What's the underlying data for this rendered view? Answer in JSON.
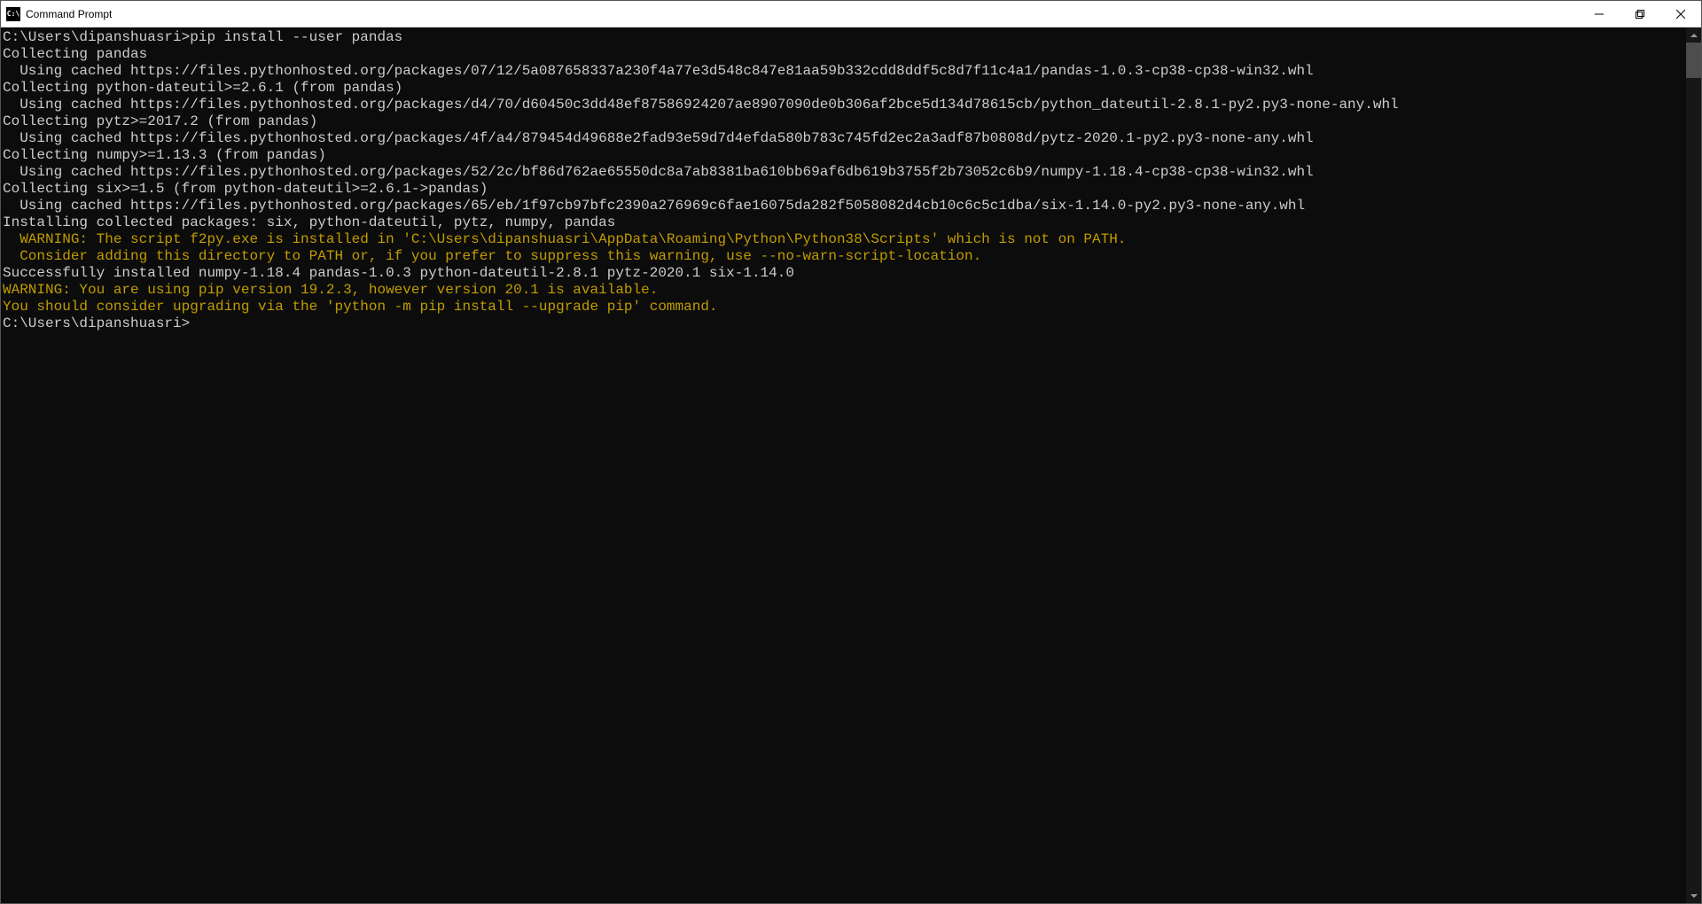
{
  "window": {
    "title": "Command Prompt",
    "icon_label": "C:\\"
  },
  "terminal": {
    "lines": [
      {
        "text": "C:\\Users\\dipanshuasri>pip install --user pandas",
        "cls": ""
      },
      {
        "text": "Collecting pandas",
        "cls": ""
      },
      {
        "text": "  Using cached https://files.pythonhosted.org/packages/07/12/5a087658337a230f4a77e3d548c847e81aa59b332cdd8ddf5c8d7f11c4a1/pandas-1.0.3-cp38-cp38-win32.whl",
        "cls": ""
      },
      {
        "text": "Collecting python-dateutil>=2.6.1 (from pandas)",
        "cls": ""
      },
      {
        "text": "  Using cached https://files.pythonhosted.org/packages/d4/70/d60450c3dd48ef87586924207ae8907090de0b306af2bce5d134d78615cb/python_dateutil-2.8.1-py2.py3-none-any.whl",
        "cls": ""
      },
      {
        "text": "Collecting pytz>=2017.2 (from pandas)",
        "cls": ""
      },
      {
        "text": "  Using cached https://files.pythonhosted.org/packages/4f/a4/879454d49688e2fad93e59d7d4efda580b783c745fd2ec2a3adf87b0808d/pytz-2020.1-py2.py3-none-any.whl",
        "cls": ""
      },
      {
        "text": "Collecting numpy>=1.13.3 (from pandas)",
        "cls": ""
      },
      {
        "text": "  Using cached https://files.pythonhosted.org/packages/52/2c/bf86d762ae65550dc8a7ab8381ba610bb69af6db619b3755f2b73052c6b9/numpy-1.18.4-cp38-cp38-win32.whl",
        "cls": ""
      },
      {
        "text": "Collecting six>=1.5 (from python-dateutil>=2.6.1->pandas)",
        "cls": ""
      },
      {
        "text": "  Using cached https://files.pythonhosted.org/packages/65/eb/1f97cb97bfc2390a276969c6fae16075da282f5058082d4cb10c6c5c1dba/six-1.14.0-py2.py3-none-any.whl",
        "cls": ""
      },
      {
        "text": "Installing collected packages: six, python-dateutil, pytz, numpy, pandas",
        "cls": ""
      },
      {
        "text": "  WARNING: The script f2py.exe is installed in 'C:\\Users\\dipanshuasri\\AppData\\Roaming\\Python\\Python38\\Scripts' which is not on PATH.",
        "cls": "warn"
      },
      {
        "text": "  Consider adding this directory to PATH or, if you prefer to suppress this warning, use --no-warn-script-location.",
        "cls": "warn"
      },
      {
        "text": "Successfully installed numpy-1.18.4 pandas-1.0.3 python-dateutil-2.8.1 pytz-2020.1 six-1.14.0",
        "cls": ""
      },
      {
        "text": "WARNING: You are using pip version 19.2.3, however version 20.1 is available.",
        "cls": "warn"
      },
      {
        "text": "You should consider upgrading via the 'python -m pip install --upgrade pip' command.",
        "cls": "warn"
      },
      {
        "text": "",
        "cls": ""
      },
      {
        "text": "C:\\Users\\dipanshuasri>",
        "cls": ""
      }
    ]
  }
}
